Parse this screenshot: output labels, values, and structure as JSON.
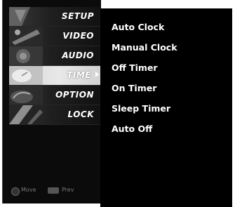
{
  "menu": {
    "items": [
      {
        "label": "SETUP",
        "icon": "setup-thumbnail-icon",
        "active": false
      },
      {
        "label": "VIDEO",
        "icon": "video-thumbnail-icon",
        "active": false
      },
      {
        "label": "AUDIO",
        "icon": "audio-thumbnail-icon",
        "active": false
      },
      {
        "label": "TIME",
        "icon": "time-thumbnail-icon",
        "active": true
      },
      {
        "label": "OPTION",
        "icon": "option-thumbnail-icon",
        "active": false
      },
      {
        "label": "LOCK",
        "icon": "lock-thumbnail-icon",
        "active": false
      }
    ],
    "hints": {
      "move": "Move",
      "prev": "Prev"
    }
  },
  "submenu": {
    "items": [
      "Auto Clock",
      "Manual Clock",
      "Off Timer",
      "On Timer",
      "Sleep Timer",
      "Auto Off"
    ]
  },
  "colors": {
    "background": "#000000",
    "text": "#ffffff",
    "active_item": "#e0e0e0"
  }
}
